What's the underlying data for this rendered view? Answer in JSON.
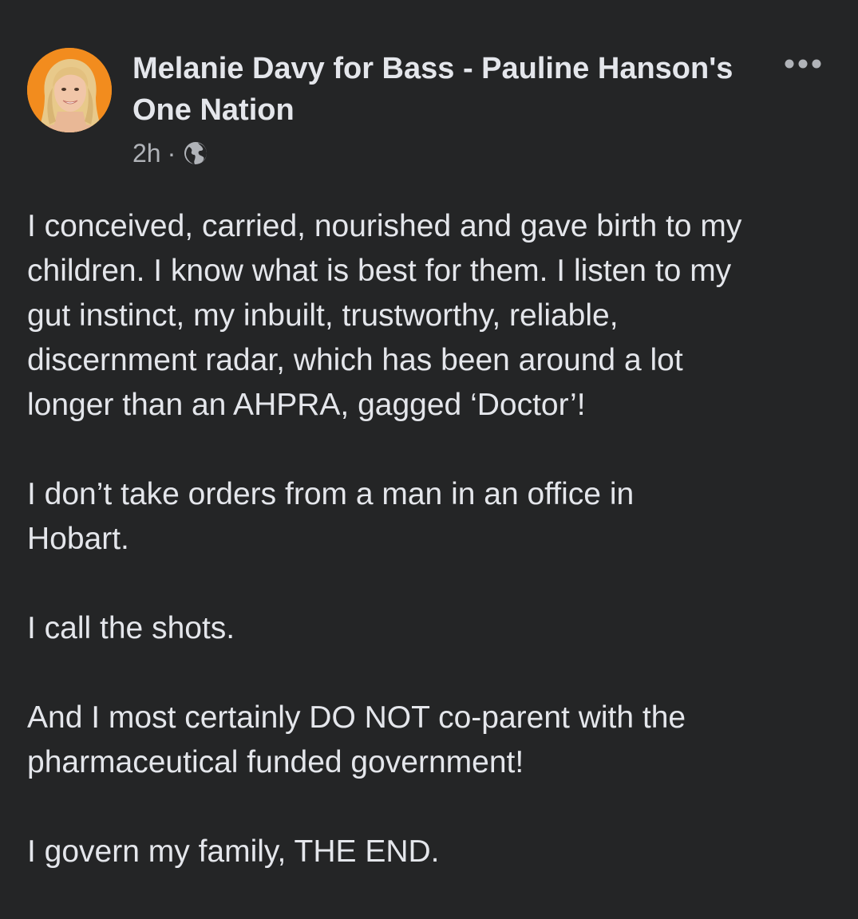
{
  "post": {
    "author": "Melanie Davy for Bass - Pauline Hanson's One Nation",
    "time": "2h",
    "separator": "·",
    "audience_icon": "globe-icon",
    "more_icon": "more-options-icon",
    "paragraphs": [
      "I conceived, carried, nourished and gave birth to my\nchildren. I know what is best for them. I listen to my\ngut instinct, my inbuilt, trustworthy, reliable,\ndiscernment radar, which has been around a lot\nlonger than an AHPRA, gagged ‘Doctor’!",
      "I don’t take orders from a man in an office in\nHobart.",
      "I call the shots.",
      "And I most certainly DO NOT co-parent with the\npharmaceutical funded government!",
      "I govern my family, THE END."
    ]
  },
  "colors": {
    "background": "#242526",
    "primary_text": "#e4e6eb",
    "secondary_text": "#b0b3b8",
    "avatar_background": "#f28c1e"
  }
}
